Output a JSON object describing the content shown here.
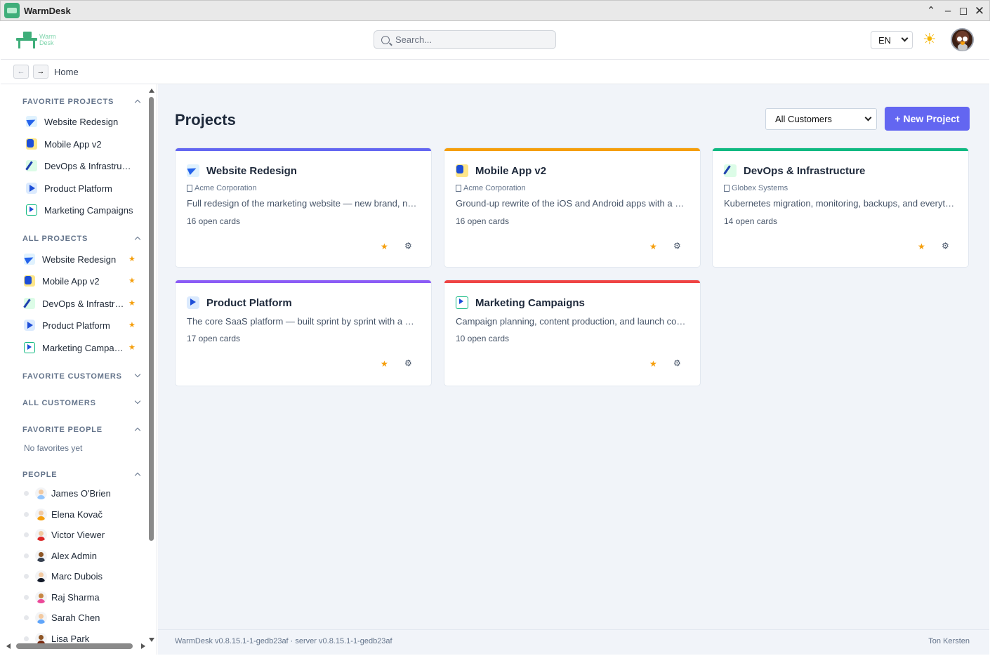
{
  "window": {
    "title": "WarmDesk"
  },
  "header": {
    "logo_line1": "Warm",
    "logo_line2": "Desk",
    "search_placeholder": "Search...",
    "language": "EN"
  },
  "breadcrumb": {
    "back": "←",
    "forward": "→",
    "current": "Home"
  },
  "sidebar": {
    "favorite_projects": {
      "heading": "FAVORITE PROJECTS",
      "items": [
        {
          "label": "Website Redesign",
          "icon": "website-icon"
        },
        {
          "label": "Mobile App v2",
          "icon": "mobile-icon"
        },
        {
          "label": "DevOps & Infrastructure",
          "icon": "devops-icon"
        },
        {
          "label": "Product Platform",
          "icon": "product-icon"
        },
        {
          "label": "Marketing Campaigns",
          "icon": "marketing-icon"
        }
      ]
    },
    "all_projects": {
      "heading": "ALL PROJECTS",
      "items": [
        {
          "label": "Website Redesign",
          "icon": "website-icon",
          "starred": true
        },
        {
          "label": "Mobile App v2",
          "icon": "mobile-icon",
          "starred": true
        },
        {
          "label": "DevOps & Infrastructure",
          "icon": "devops-icon",
          "starred": true
        },
        {
          "label": "Product Platform",
          "icon": "product-icon",
          "starred": true
        },
        {
          "label": "Marketing Campaigns",
          "icon": "marketing-icon",
          "starred": true
        }
      ]
    },
    "favorite_customers": {
      "heading": "FAVORITE CUSTOMERS"
    },
    "all_customers": {
      "heading": "ALL CUSTOMERS"
    },
    "favorite_people": {
      "heading": "FAVORITE PEOPLE",
      "empty": "No favorites yet"
    },
    "people": {
      "heading": "PEOPLE",
      "items": [
        {
          "name": "James O'Brien"
        },
        {
          "name": "Elena Kovač"
        },
        {
          "name": "Victor Viewer"
        },
        {
          "name": "Alex Admin"
        },
        {
          "name": "Marc Dubois"
        },
        {
          "name": "Raj Sharma"
        },
        {
          "name": "Sarah Chen"
        },
        {
          "name": "Lisa Park"
        }
      ]
    }
  },
  "main": {
    "title": "Projects",
    "customer_filter": "All Customers",
    "new_project": "+ New Project",
    "projects": [
      {
        "name": "Website Redesign",
        "customer": "Acme Corporation",
        "description": "Full redesign of the marketing website — new brand, ne...",
        "open_cards": "16 open cards",
        "color": "#6366f1",
        "icon": "website-icon"
      },
      {
        "name": "Mobile App v2",
        "customer": "Acme Corporation",
        "description": "Ground-up rewrite of the iOS and Android apps with a sh...",
        "open_cards": "16 open cards",
        "color": "#f59e0b",
        "icon": "mobile-icon"
      },
      {
        "name": "DevOps & Infrastructure",
        "customer": "Globex Systems",
        "description": "Kubernetes migration, monitoring, backups, and everythi...",
        "open_cards": "14 open cards",
        "color": "#10b981",
        "icon": "devops-icon"
      },
      {
        "name": "Product Platform",
        "customer": "",
        "description": "The core SaaS platform — built sprint by sprint with a cr...",
        "open_cards": "17 open cards",
        "color": "#8b5cf6",
        "icon": "product-icon"
      },
      {
        "name": "Marketing Campaigns",
        "customer": "",
        "description": "Campaign planning, content production, and launch coo...",
        "open_cards": "10 open cards",
        "color": "#ef4444",
        "icon": "marketing-icon"
      }
    ]
  },
  "footer": {
    "version": "WarmDesk v0.8.15.1-1-gedb23af",
    "server": " · server v0.8.15.1-1-gedb23af",
    "user": "Ton Kersten"
  }
}
